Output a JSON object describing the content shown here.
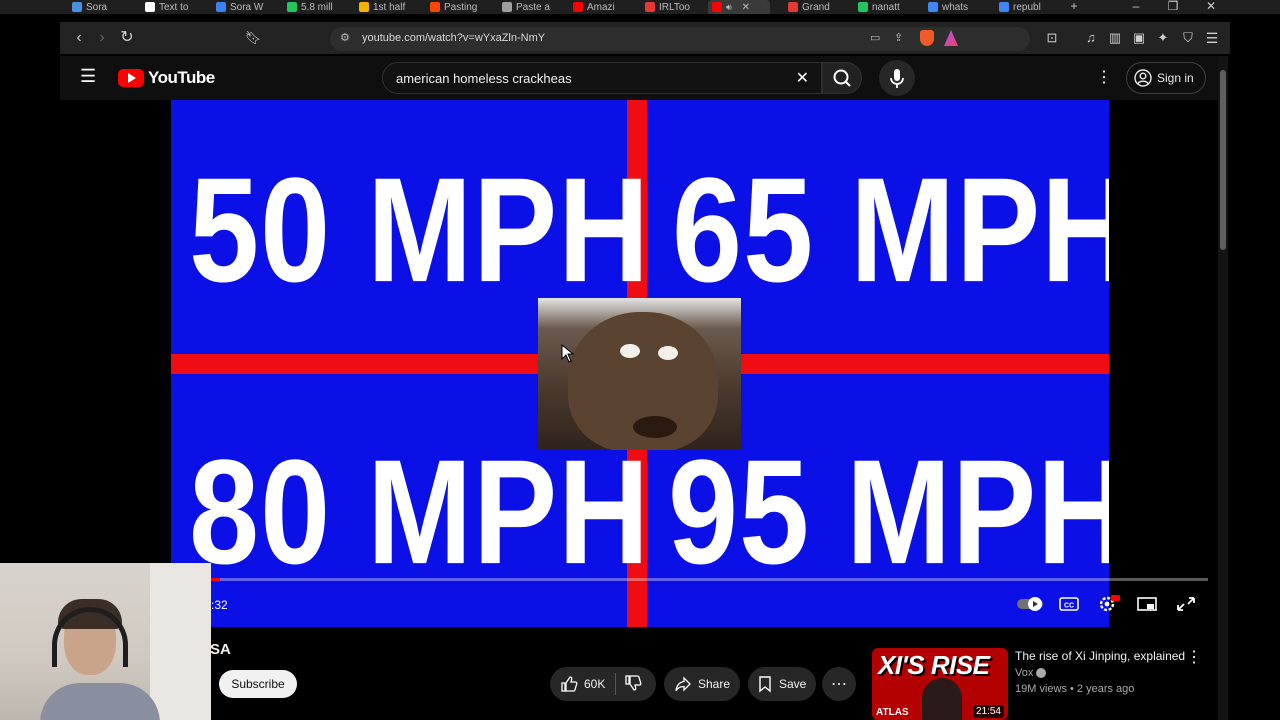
{
  "browser": {
    "tabs": [
      {
        "label": "Sora",
        "color": "#4a90e2"
      },
      {
        "label": "Text to",
        "color": "#ffffff"
      },
      {
        "label": "Sora W",
        "color": "#3b82f6"
      },
      {
        "label": "5.8 mill",
        "color": "#22c55e"
      },
      {
        "label": "1st half",
        "color": "#f4b400"
      },
      {
        "label": "Pasting",
        "color": "#ff4500"
      },
      {
        "label": "Paste a",
        "color": "#9e9e9e"
      },
      {
        "label": "Amazi",
        "color": "#ff0000"
      },
      {
        "label": "IRLToo",
        "color": "#e53935"
      },
      {
        "label": "",
        "color": "#ff0000",
        "active": true
      },
      {
        "label": "Grand",
        "color": "#e53935"
      },
      {
        "label": "nanatt",
        "color": "#22c55e"
      },
      {
        "label": "whats",
        "color": "#4285f4"
      },
      {
        "label": "republ",
        "color": "#4285f4"
      }
    ],
    "url": "youtube.com/watch?v=wYxaZln-NmY"
  },
  "youtube": {
    "logo_text": "YouTube",
    "search_query": "american homeless crackheas",
    "sign_in_label": "Sign in"
  },
  "video": {
    "quadrants": [
      "50 MPH",
      "65 MPH",
      "80 MPH",
      "95 MPH"
    ],
    "time": ":32",
    "progress_fraction": 0.01
  },
  "below_video": {
    "channel_name": "SA",
    "subscribe_label": "Subscribe",
    "likes": "60K",
    "share_label": "Share",
    "save_label": "Save"
  },
  "suggested": {
    "thumb_text": "XI'S RISE",
    "thumb_badge": "ATLAS",
    "duration": "21:54",
    "title": "The rise of Xi Jinping, explained",
    "channel": "Vox",
    "meta": "19M views • 2 years ago"
  },
  "colors": {
    "video_blue": "#0b11e6",
    "video_red": "#ef0d13",
    "yt_red": "#ff0000"
  }
}
